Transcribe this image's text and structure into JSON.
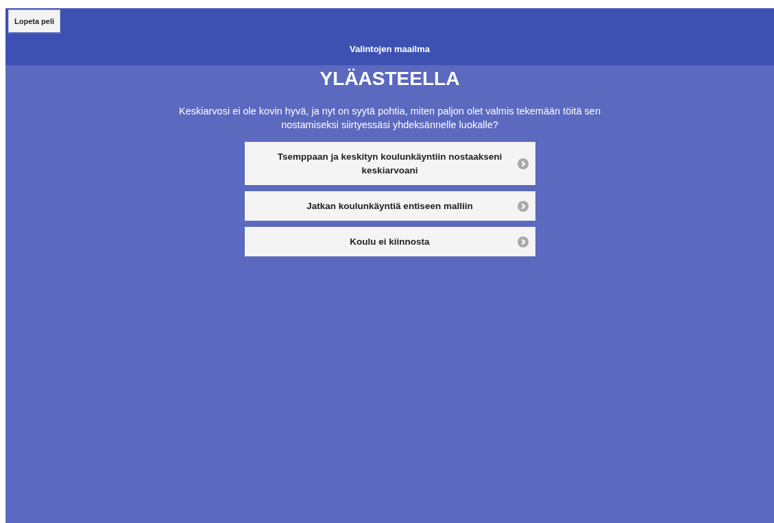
{
  "quit_button": "Lopeta peli",
  "header": {
    "title": "Valintojen maailma"
  },
  "heading": "YLÄASTEELLA",
  "question": "Keskiarvosi ei ole kovin hyvä, ja nyt on syytä pohtia, miten paljon olet valmis tekemään töitä sen nostamiseksi siirtyessäsi yhdeksännelle luokalle?",
  "options": [
    {
      "label": "Tsemppaan ja keskityn koulunkäyntiin nostaakseni keskiarvoani"
    },
    {
      "label": "Jatkan koulunkäyntiä entiseen malliin"
    },
    {
      "label": "Koulu ei kiinnosta"
    }
  ]
}
